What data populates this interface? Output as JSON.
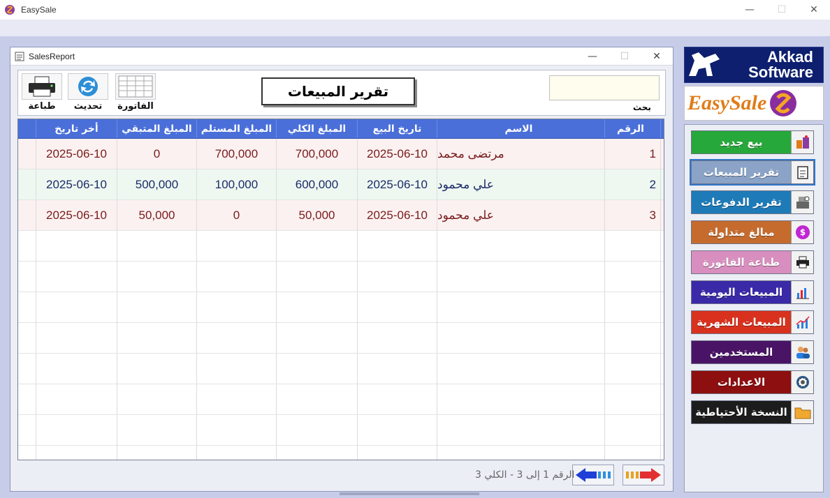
{
  "app": {
    "title": "EasySale"
  },
  "window": {
    "title": "SalesReport"
  },
  "toolbar": {
    "print_label": "طباعة",
    "refresh_label": "تحديث",
    "invoice_label": "الفاتورة",
    "report_title": "تقرير المبيعات",
    "search_label": "بحث",
    "search_value": ""
  },
  "table": {
    "headers": [
      "أخر تاريخ",
      "المبلغ المتبقي",
      "المبلغ المستلم",
      "المبلغ الكلي",
      "تاريخ البيع",
      "الاسم",
      "الرقم"
    ],
    "rows": [
      {
        "last_date": "2025-06-10",
        "remaining": "0",
        "received": "700,000",
        "total": "700,000",
        "sale_date": "2025-06-10",
        "name": "مرتضى محمد",
        "num": "1"
      },
      {
        "last_date": "2025-06-10",
        "remaining": "500,000",
        "received": "100,000",
        "total": "600,000",
        "sale_date": "2025-06-10",
        "name": "علي محمود",
        "num": "2"
      },
      {
        "last_date": "2025-06-10",
        "remaining": "50,000",
        "received": "0",
        "total": "50,000",
        "sale_date": "2025-06-10",
        "name": "علي محمود",
        "num": "3"
      }
    ]
  },
  "pager": {
    "text": "الرقم 1 إلى 3 - الكلي 3"
  },
  "brand": {
    "akkad_line1": "Akkad",
    "akkad_line2": "Software",
    "easysale": "EasySale"
  },
  "sidebar": {
    "items": [
      {
        "label": "بيع جديد",
        "color": "#27a83a",
        "icon": "products-icon"
      },
      {
        "label": "تقرير المبيعات",
        "color": "#8aa3c7",
        "icon": "clipboard-icon"
      },
      {
        "label": "تقرير الدفوعات",
        "color": "#1e7bb8",
        "icon": "cash-register-icon"
      },
      {
        "label": "مبالغ متداولة",
        "color": "#c56b2e",
        "icon": "currency-icon"
      },
      {
        "label": "طباعة الفاتورة",
        "color": "#d88ebf",
        "icon": "printer-icon"
      },
      {
        "label": "المبيعات اليومية",
        "color": "#3a2aa8",
        "icon": "bar-chart-icon"
      },
      {
        "label": "المبيعات الشهرية",
        "color": "#d8321e",
        "icon": "line-chart-icon"
      },
      {
        "label": "المستخدمين",
        "color": "#4a1466",
        "icon": "users-icon"
      },
      {
        "label": "الاعدادات",
        "color": "#8e0f0f",
        "icon": "gear-icon"
      },
      {
        "label": "النسخة الأحتياطية",
        "color": "#1c1c1c",
        "icon": "folder-icon"
      }
    ]
  }
}
